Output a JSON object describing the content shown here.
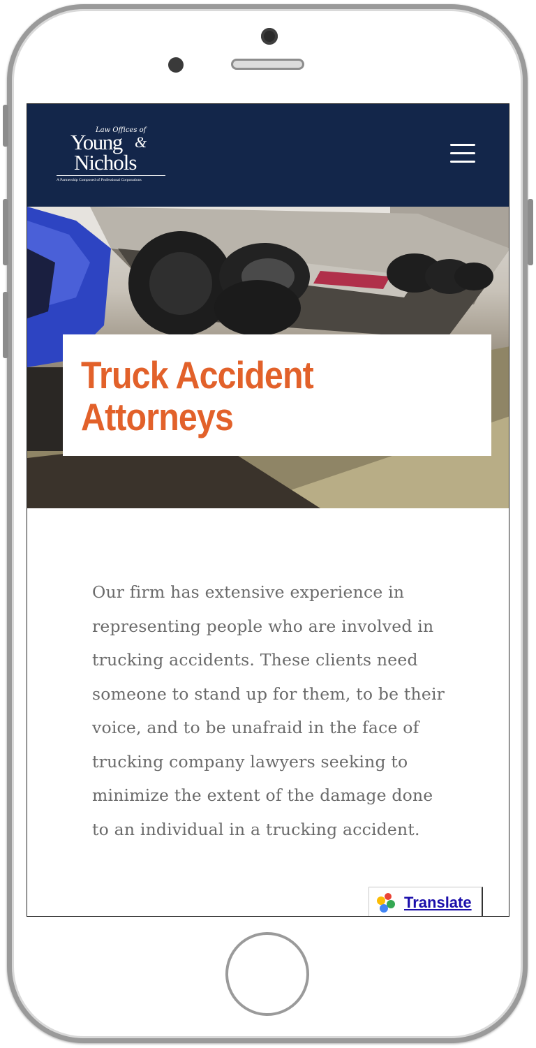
{
  "header": {
    "logo": {
      "prefix": "Law Offices of",
      "line1": "Young",
      "ampersand": "&",
      "line2": "Nichols",
      "tagline": "A Partnership Composed of Professional Corporations"
    },
    "menu_icon": "hamburger-menu-icon",
    "background_color": "#13264a"
  },
  "hero": {
    "image": "overturned semi truck in a roadside ditch",
    "title": "Truck Accident Attorneys",
    "title_color": "#e2612a"
  },
  "content": {
    "paragraph": "Our firm has extensive experience in representing people who are involved in trucking accidents. These clients need someone to stand up for them, to be their voice, and to be unafraid in the face of trucking company lawyers seeking to minimize the extent of the damage done to an individual in a trucking accident."
  },
  "translate_widget": {
    "icon": "google-translate-icon",
    "label": "Translate"
  }
}
